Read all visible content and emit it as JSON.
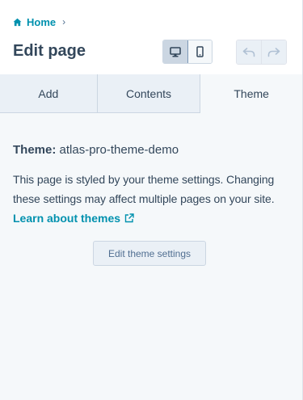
{
  "header": {
    "breadcrumb": {
      "home_label": "Home",
      "separator": "›"
    },
    "title": "Edit page",
    "view_toggle": {
      "active": "desktop"
    },
    "history": {
      "undo_enabled": false,
      "redo_enabled": false
    }
  },
  "tabs": [
    {
      "label": "Add",
      "active": false
    },
    {
      "label": "Contents",
      "active": false
    },
    {
      "label": "Theme",
      "active": true
    }
  ],
  "theme_panel": {
    "theme_label": "Theme:",
    "theme_name": "atlas-pro-theme-demo",
    "description": "This page is styled by your theme settings. Changing these settings may affect multiple pages on your site.",
    "learn_link": "Learn about themes",
    "edit_button": "Edit theme settings"
  },
  "colors": {
    "accent": "#0091ae",
    "text": "#33475b",
    "background": "#f5f8fa",
    "tab_background": "#eaf0f6",
    "border": "#cbd6e2"
  },
  "icons": [
    "home-icon",
    "desktop-icon",
    "mobile-icon",
    "undo-icon",
    "redo-icon",
    "external-link-icon"
  ]
}
